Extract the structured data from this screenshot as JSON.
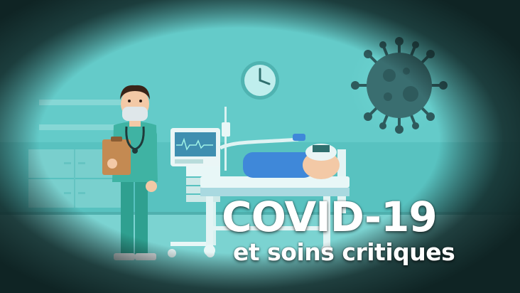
{
  "title": "COVID-19",
  "subtitle": "et soins critiques",
  "icons": [
    "doctor-illustration",
    "clock-icon",
    "virus-icon",
    "ventilator-monitor",
    "patient-bed"
  ],
  "colors": {
    "background_teal": "#5fc6c4",
    "vignette": "#0f2424",
    "scrubs": "#3fb3a3",
    "blanket": "#3f88d9",
    "virus": "#2e5a5c",
    "text": "#ffffff"
  }
}
